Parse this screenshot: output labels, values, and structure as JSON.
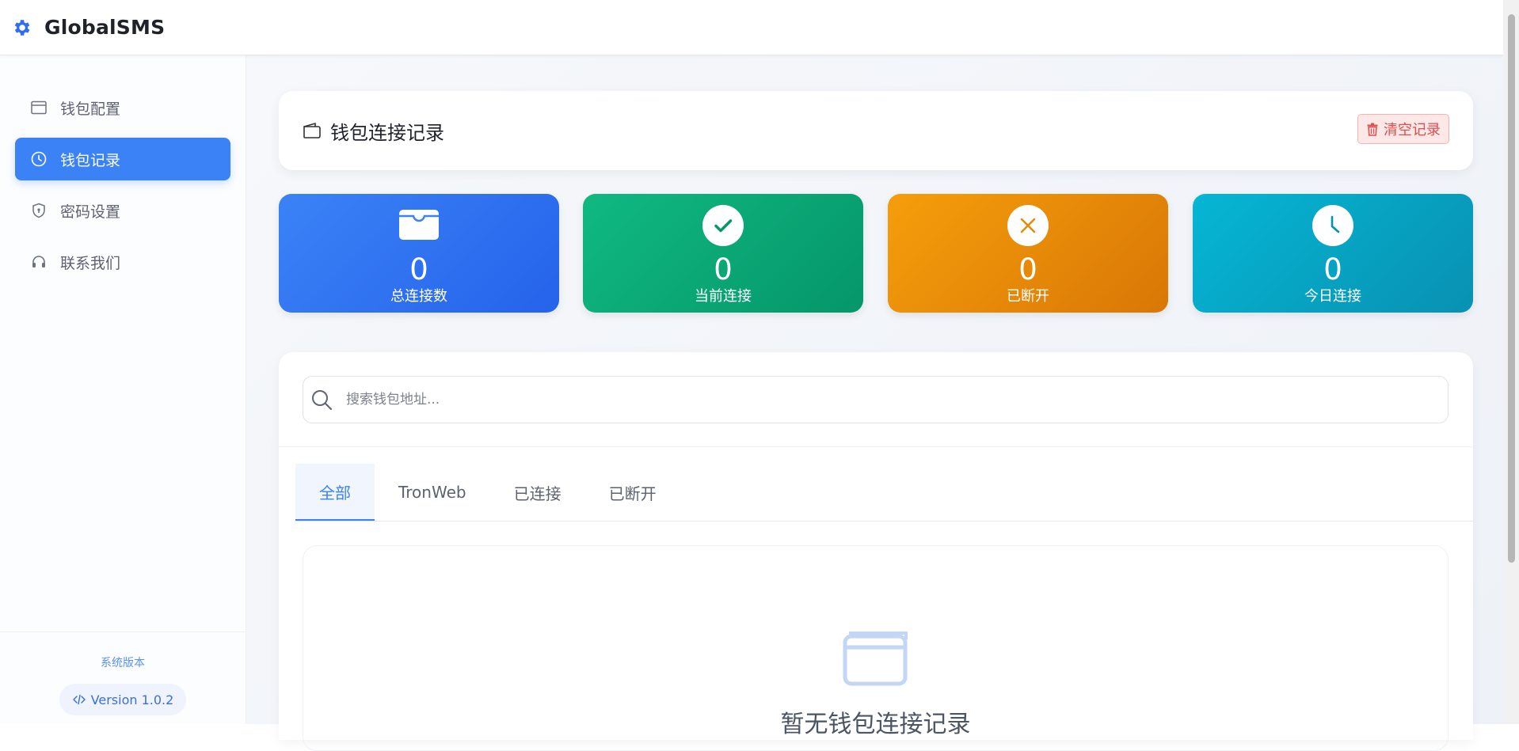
{
  "app": {
    "brand": "GlobalSMS"
  },
  "sidebar": {
    "items": [
      {
        "label": "钱包配置",
        "icon": "window-icon",
        "active": false
      },
      {
        "label": "钱包记录",
        "icon": "clock-icon",
        "active": true
      },
      {
        "label": "密码设置",
        "icon": "shield-icon",
        "active": false
      },
      {
        "label": "联系我们",
        "icon": "headset-icon",
        "active": false
      }
    ],
    "footer": {
      "caption": "系统版本",
      "version": "Version 1.0.2"
    }
  },
  "header": {
    "title": "钱包连接记录",
    "clear_label": "清空记录"
  },
  "stats": [
    {
      "value": "0",
      "label": "总连接数",
      "icon": "wallet-icon"
    },
    {
      "value": "0",
      "label": "当前连接",
      "icon": "check-circle-icon"
    },
    {
      "value": "0",
      "label": "已断开",
      "icon": "x-circle-icon"
    },
    {
      "value": "0",
      "label": "今日连接",
      "icon": "clock-circle-icon"
    }
  ],
  "search": {
    "placeholder": "搜索钱包地址..."
  },
  "tabs": [
    {
      "label": "全部",
      "active": true
    },
    {
      "label": "TronWeb",
      "active": false
    },
    {
      "label": "已连接",
      "active": false
    },
    {
      "label": "已断开",
      "active": false
    }
  ],
  "empty": {
    "text": "暂无钱包连接记录"
  },
  "colors": {
    "primary": "#3b82f6",
    "success": "#10b981",
    "warning": "#f59e0b",
    "info": "#06b6d4",
    "danger": "#e24c4c"
  }
}
